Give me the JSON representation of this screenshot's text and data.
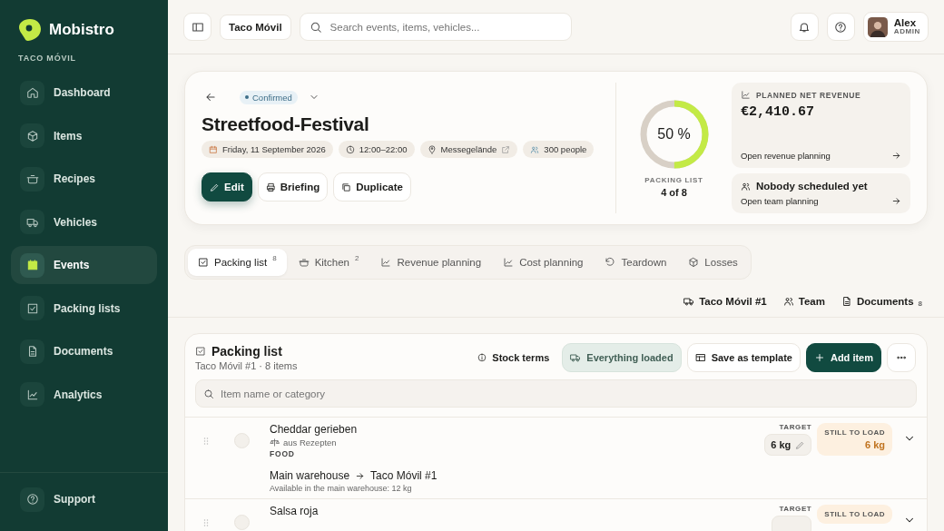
{
  "sidebar": {
    "brand": "Mobistro",
    "workspace": "TACO MÓVIL",
    "items": [
      {
        "label": "Dashboard",
        "selected": false
      },
      {
        "label": "Items",
        "selected": false
      },
      {
        "label": "Recipes",
        "selected": false
      },
      {
        "label": "Vehicles",
        "selected": false
      },
      {
        "label": "Events",
        "selected": true
      },
      {
        "label": "Packing lists",
        "selected": false
      },
      {
        "label": "Documents",
        "selected": false
      },
      {
        "label": "Analytics",
        "selected": false
      }
    ],
    "footer_item": {
      "label": "Support"
    }
  },
  "topbar": {
    "workspace_button": "Taco Móvil",
    "search": {
      "placeholder": "Search events, items, vehicles..."
    },
    "user": {
      "name": "Alex",
      "role": "ADMIN"
    }
  },
  "event": {
    "status": "Confirmed",
    "title": "Streetfood-Festival",
    "chips": [
      {
        "kind": "date",
        "label": "Friday, 11 September 2026"
      },
      {
        "kind": "time",
        "label": "12:00–22:00"
      },
      {
        "kind": "location",
        "label": "Messegelände",
        "external": true
      },
      {
        "kind": "people",
        "label": "300 people"
      }
    ],
    "actions": [
      {
        "kind": "primary",
        "label": "Edit"
      },
      {
        "kind": "print",
        "label": "Briefing"
      },
      {
        "kind": "copy",
        "label": "Duplicate"
      }
    ],
    "progress": {
      "level": 0.5,
      "percent": "50 %",
      "label": "PACKING LIST",
      "count": "4 of 8"
    },
    "revenue": {
      "label": "PLANNED NET REVENUE",
      "value": "€2,410.67",
      "link": "Open revenue planning"
    },
    "team": {
      "title": "Nobody scheduled yet",
      "link": "Open team planning"
    }
  },
  "tabs": [
    {
      "label": "Packing list",
      "count": "8",
      "selected": true
    },
    {
      "label": "Kitchen",
      "count": "2",
      "selected": false
    },
    {
      "label": "Revenue planning",
      "selected": false
    },
    {
      "label": "Cost planning",
      "selected": false
    },
    {
      "label": "Teardown",
      "selected": false
    },
    {
      "label": "Losses",
      "selected": false
    }
  ],
  "resource_links": [
    {
      "label": "Taco Móvil #1"
    },
    {
      "label": "Team"
    },
    {
      "label": "Documents",
      "count": "8"
    }
  ],
  "packing_list": {
    "title": "Packing list",
    "subtitle": "Taco Móvil #1 · 8 items",
    "actions": [
      {
        "kind": "link",
        "label": "Stock terms"
      },
      {
        "kind": "tinted",
        "label": "Everything loaded"
      },
      {
        "kind": "outline",
        "label": "Save as template"
      },
      {
        "kind": "primary",
        "label": "Add item"
      }
    ],
    "search": {
      "placeholder": "Item name or category"
    },
    "rows": [
      {
        "name": "Cheddar gerieben",
        "source": "aus Rezepten",
        "category": "FOOD",
        "from": "Main warehouse",
        "to": "Taco Móvil #1",
        "availability": "Available in the main warehouse: 12 kg",
        "target_label": "TARGET",
        "target": "6 kg",
        "still_label": "STILL TO LOAD",
        "still": "6 kg",
        "checked": false
      },
      {
        "name": "Salsa roja",
        "target_label": "TARGET",
        "still_label": "STILL TO LOAD",
        "checked": false
      }
    ]
  }
}
